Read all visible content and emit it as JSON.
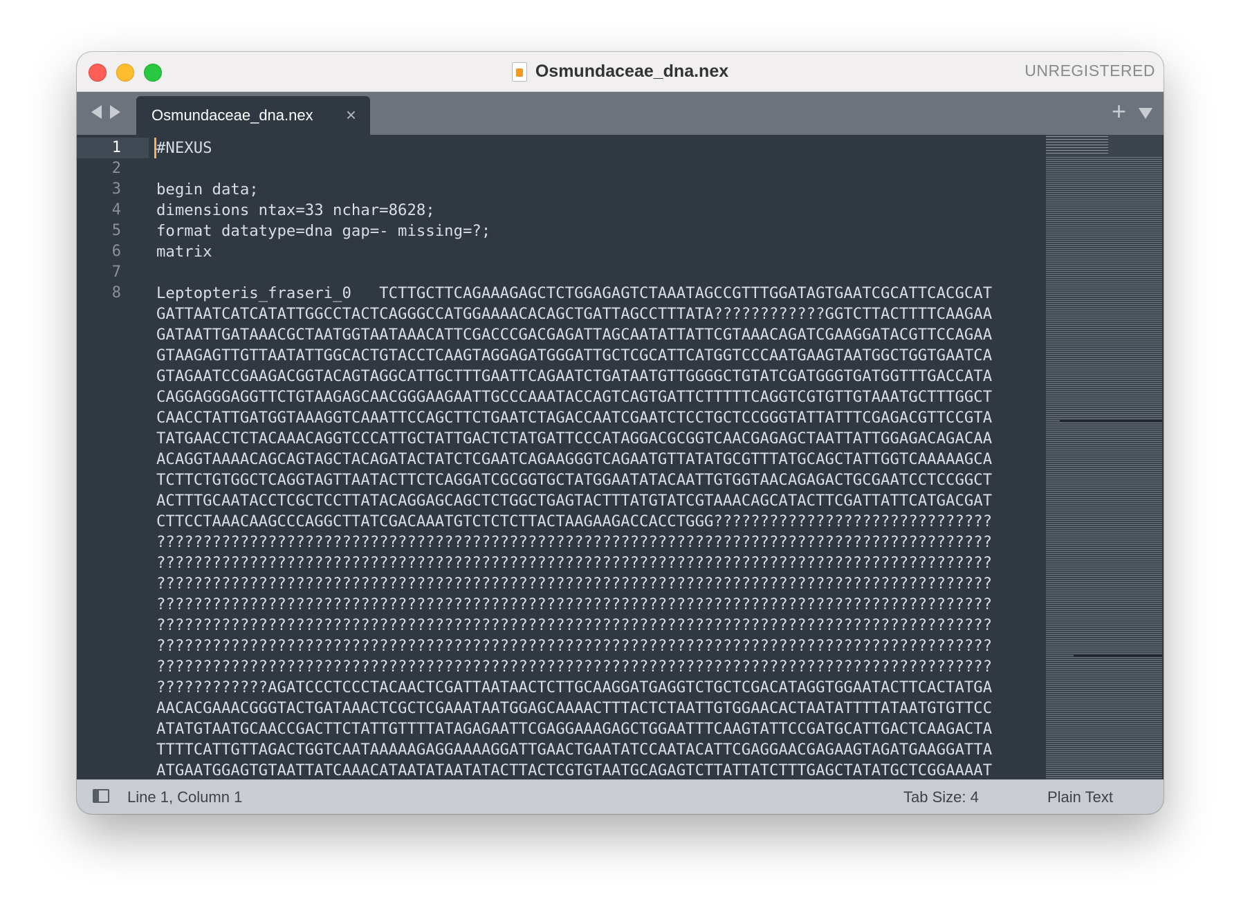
{
  "window": {
    "title": "Osmundaceae_dna.nex",
    "registration": "UNREGISTERED"
  },
  "tabs": [
    {
      "label": "Osmundaceae_dna.nex",
      "close": "×",
      "active": true
    }
  ],
  "toolbar": {
    "new_tab": "+"
  },
  "gutter": [
    "1",
    "2",
    "3",
    "4",
    "5",
    "6",
    "7",
    "8"
  ],
  "code_lines": [
    "#NEXUS",
    "",
    "begin data;",
    "dimensions ntax=33 nchar=8628;",
    "format datatype=dna gap=- missing=?;",
    "matrix",
    "",
    "Leptopteris_fraseri_0   TCTTGCTTCAGAAAGAGCTCTGGAGAGTCTAAATAGCCGTTTGGATAGTGAATCGCATTCACGCAT",
    "GATTAATCATCATATTGGCCTACTCAGGGCCATGGAAAACACAGCTGATTAGCCTTTATA????????????GGTCTTACTTTTCAAGAA",
    "GATAATTGATAAACGCTAATGGTAATAAACATTCGACCCGACGAGATTAGCAATATTATTCGTAAACAGATCGAAGGATACGTTCCAGAA",
    "GTAAGAGTTGTTAATATTGGCACTGTACCTCAAGTAGGAGATGGGATTGCTCGCATTCATGGTCCCAATGAAGTAATGGCTGGTGAATCA",
    "GTAGAATCCGAAGACGGTACAGTAGGCATTGCTTTGAATTCAGAATCTGATAATGTTGGGGCTGTATCGATGGGTGATGGTTTGACCATA",
    "CAGGAGGGAGGTTCTGTAAGAGCAACGGGAAGAATTGCCCAAATACCAGTCAGTGATTCTTTTTCAGGTCGTGTTGTAAATGCTTTGGCT",
    "CAACCTATTGATGGTAAAGGTCAAATTCCAGCTTCTGAATCTAGACCAATCGAATCTCCTGCTCCGGGTATTATTTCGAGACGTTCCGTA",
    "TATGAACCTCTACAAACAGGTCCCATTGCTATTGACTCTATGATTCCCATAGGACGCGGTCAACGAGAGCTAATTATTGGAGACAGACAA",
    "ACAGGTAAAACAGCAGTAGCTACAGATACTATCTCGAATCAGAAGGGTCAGAATGTTATATGCGTTTATGCAGCTATTGGTCAAAAAGCA",
    "TCTTCTGTGGCTCAGGTAGTTAATACTTCTCAGGATCGCGGTGCTATGGAATATACAATTGTGGTAACAGAGACTGCGAATCCTCCGGCT",
    "ACTTTGCAATACCTCGCTCCTTATACAGGAGCAGCTCTGGCTGAGTACTTTATGTATCGTAAACAGCATACTTCGATTATTCATGACGAT",
    "CTTCCTAAACAAGCCCAGGCTTATCGACAAATGTCTCTCTTACTAAGAAGACCACCTGGG??????????????????????????????",
    "??????????????????????????????????????????????????????????????????????????????????????????",
    "??????????????????????????????????????????????????????????????????????????????????????????",
    "??????????????????????????????????????????????????????????????????????????????????????????",
    "??????????????????????????????????????????????????????????????????????????????????????????",
    "??????????????????????????????????????????????????????????????????????????????????????????",
    "??????????????????????????????????????????????????????????????????????????????????????????",
    "??????????????????????????????????????????????????????????????????????????????????????????",
    "????????????AGATCCCTCCCTACAACTCGATTAATAACTCTTGCAAGGATGAGGTCTGCTCGACATAGGTGGAATACTTCACTATGA",
    "AACACGAAACGGGTACTGATAAACTCGCTCGAAATAATGGAGCAAAACTTTACTCTAATTGTGGAACACTAATATTTTATAATGTGTTCC",
    "ATATGTAATGCAACCGACTTCTATTGTTTTATAGAGAATTCGAGGAAAGAGCTGGAATTTCAAGTATTCCGATGCATTGACTCAAGACTA",
    "TTTTCATTGTTAGACTGGTCAATAAAAAGAGGAAAAGGATTGAACTGAATATCCAATACATTCGAGGAACGAGAAGTAGATGAAGGATTA",
    "ATGAATGGAGTGTAATTATCAAACATAATATAATATACTTACTCGTGTAATGCAGAGTCTTATTATCTTTGAGCTATATGCTCGGAAAAT"
  ],
  "status": {
    "position": "Line 1, Column 1",
    "tab_size": "Tab Size: 4",
    "syntax": "Plain Text"
  },
  "colors": {
    "editor_bg": "#303841",
    "cursor": "#f9ae58",
    "text": "#d8dee9"
  }
}
